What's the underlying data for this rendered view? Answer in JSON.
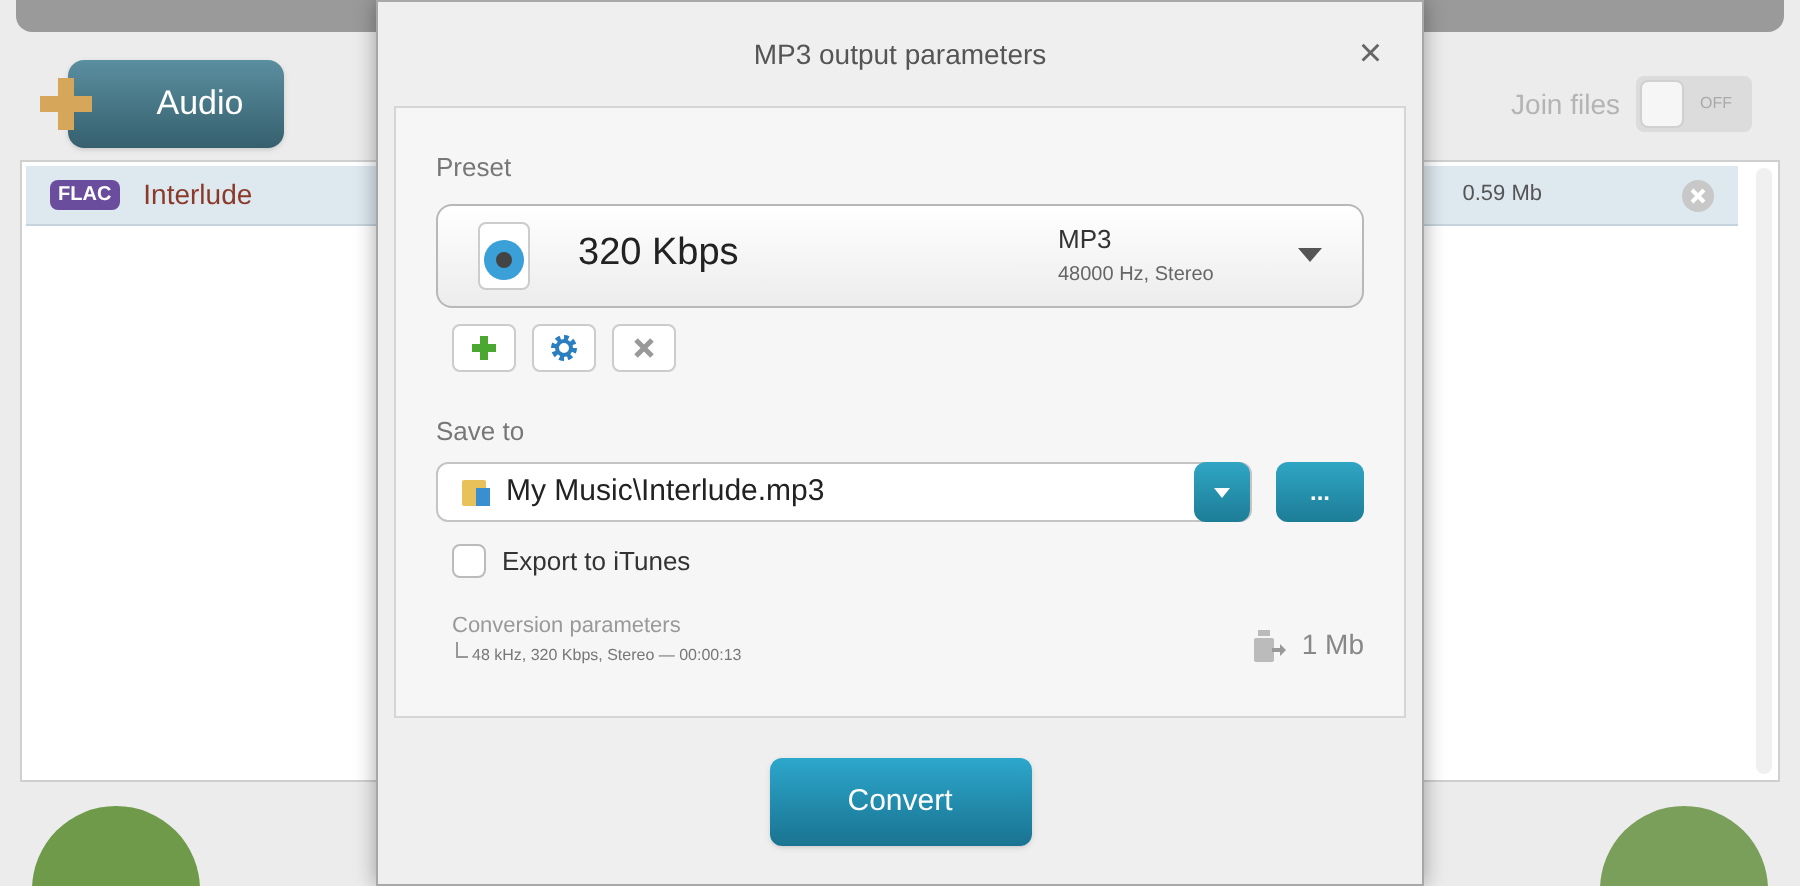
{
  "toolbar": {
    "add_button": "Audio",
    "join_files": {
      "label": "Join files",
      "on": false,
      "state_text": "OFF"
    }
  },
  "file_list": {
    "rows": [
      {
        "format": "FLAC",
        "name": "Interlude",
        "size": "0.59 Mb",
        "selected": true
      }
    ]
  },
  "dialog": {
    "title": "MP3 output parameters",
    "close": "×",
    "preset": {
      "label": "Preset",
      "name": "320 Kbps",
      "format": "MP3",
      "details": "48000 Hz,  Stereo"
    },
    "save_to": {
      "label": "Save to",
      "value": "My Music\\Interlude.mp3",
      "browse": "..."
    },
    "export_itunes": {
      "label": "Export to iTunes",
      "checked": false
    },
    "conversion": {
      "label": "Conversion parameters",
      "details": "48 kHz, 320 Kbps, Stereo — 00:00:13",
      "size": "1 Mb"
    },
    "convert_button": "Convert"
  }
}
